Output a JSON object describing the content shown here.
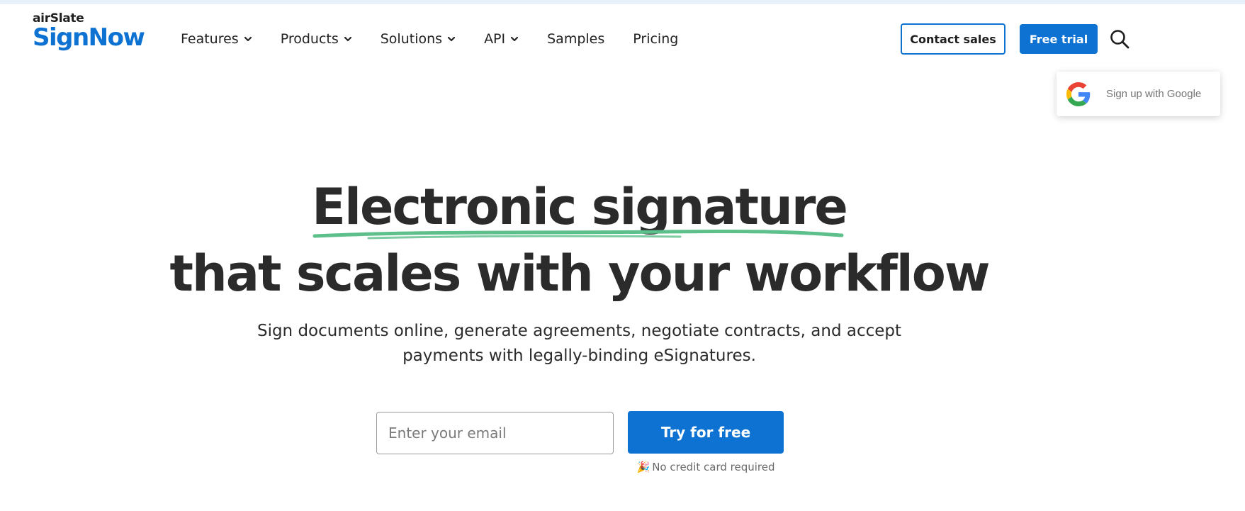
{
  "brand": {
    "top": "airSlate",
    "main": "SignNow",
    "color": "#0d72d1"
  },
  "nav": {
    "items": [
      {
        "label": "Features",
        "dropdown": true
      },
      {
        "label": "Products",
        "dropdown": true
      },
      {
        "label": "Solutions",
        "dropdown": true
      },
      {
        "label": "API",
        "dropdown": true
      },
      {
        "label": "Samples",
        "dropdown": false
      },
      {
        "label": "Pricing",
        "dropdown": false
      }
    ]
  },
  "header": {
    "contact_label": "Contact sales",
    "free_trial_label": "Free trial",
    "search_icon": "search-icon"
  },
  "google": {
    "label": "Sign up with Google",
    "icon": "google-icon"
  },
  "hero": {
    "line1": "Electronic signature",
    "line2": "that scales with your workflow",
    "subtitle_line1": "Sign documents online, generate agreements, negotiate contracts, and accept",
    "subtitle_line2": "payments with legally-binding eSignatures.",
    "underline_color": "#5dbf8a"
  },
  "signup": {
    "email_placeholder": "Enter your email",
    "email_value": "",
    "button_label": "Try for free",
    "note_icon": "party-popper-icon",
    "note": "No credit card required"
  },
  "colors": {
    "accent": "#0d72d1",
    "text": "#2b2b2b"
  }
}
